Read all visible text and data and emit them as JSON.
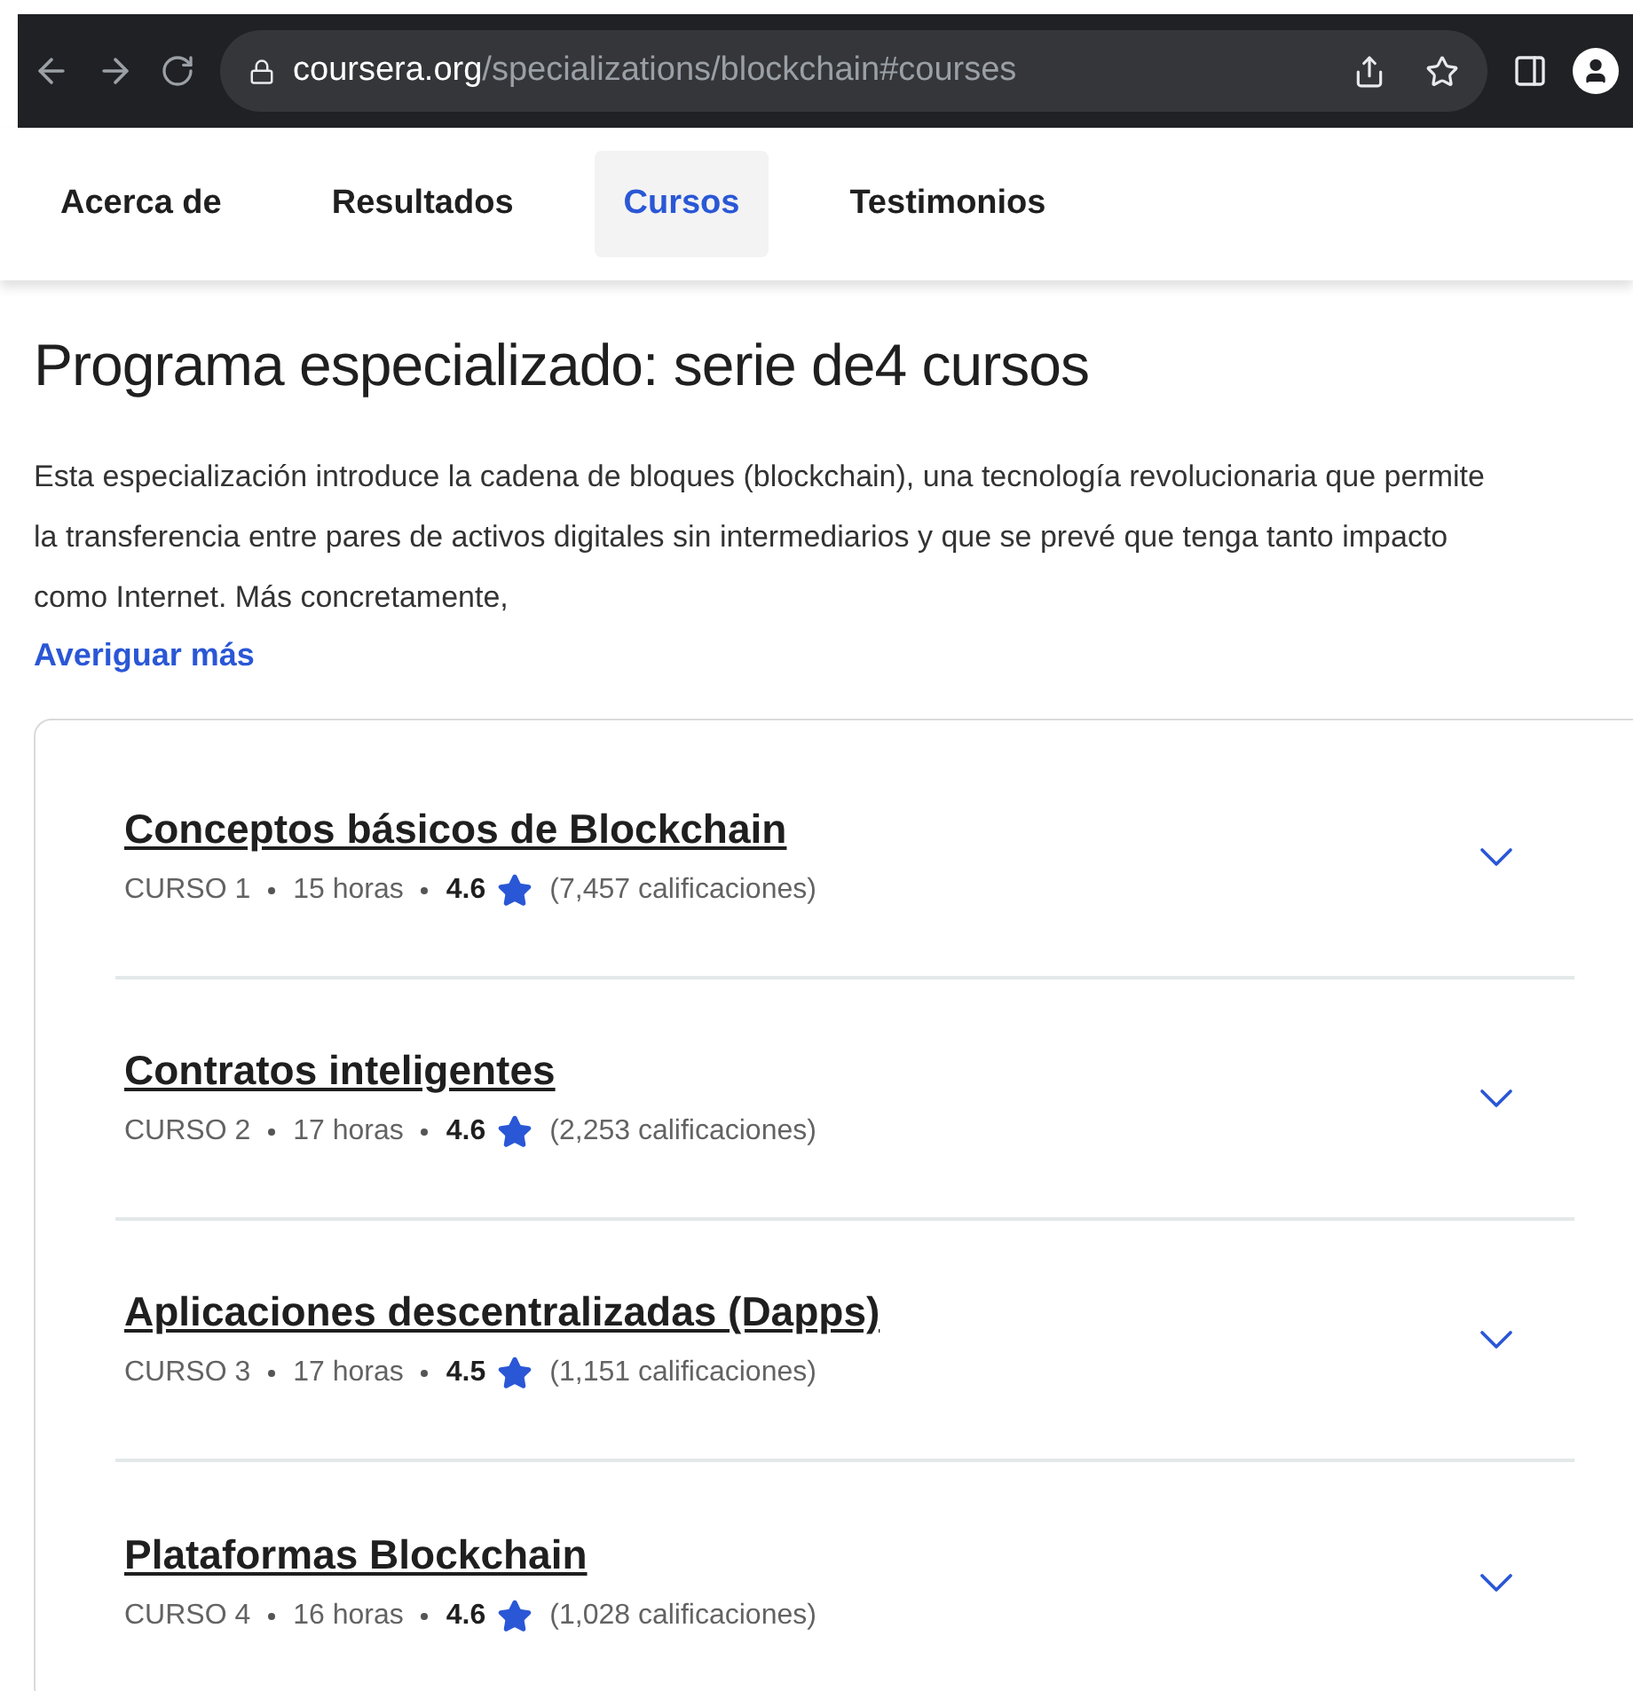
{
  "browser": {
    "url_host": "coursera.org",
    "url_path": "/specializations/blockchain#courses"
  },
  "tabs": [
    {
      "label": "Acerca de",
      "selected": false
    },
    {
      "label": "Resultados",
      "selected": false
    },
    {
      "label": "Cursos",
      "selected": true
    },
    {
      "label": "Testimonios",
      "selected": false
    }
  ],
  "heading": "Programa especializado: serie de4 cursos",
  "description": "Esta especialización introduce la cadena de bloques (blockchain), una tecnología revolucionaria que permite la transferencia entre pares de activos digitales sin intermediarios y que se prevé que tenga tanto impacto como Internet. Más concretamente,",
  "more_link": "Averiguar más",
  "courses": [
    {
      "title": "Conceptos básicos de Blockchain",
      "number": "CURSO 1",
      "hours": "15 horas",
      "rating": "4.6",
      "ratings_count": "(7,457 calificaciones)",
      "expanded": false
    },
    {
      "title": "Contratos inteligentes",
      "number": "CURSO 2",
      "hours": "17 horas",
      "rating": "4.6",
      "ratings_count": "(2,253 calificaciones)",
      "expanded": false
    },
    {
      "title": "Aplicaciones descentralizadas (Dapps)",
      "number": "CURSO 3",
      "hours": "17 horas",
      "rating": "4.5",
      "ratings_count": "(1,151 calificaciones)",
      "expanded": false
    },
    {
      "title": "Plataformas Blockchain",
      "number": "CURSO 4",
      "hours": "16 horas",
      "rating": "4.6",
      "ratings_count": "(1,028 calificaciones)",
      "expanded": false
    }
  ]
}
